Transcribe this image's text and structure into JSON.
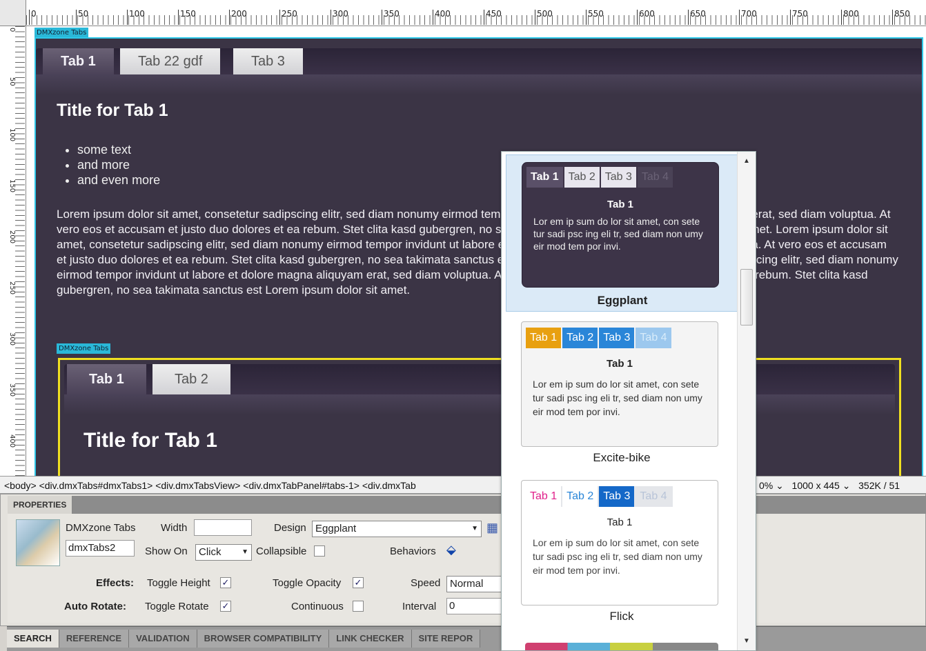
{
  "ruler": {
    "labels": [
      "0",
      "50",
      "100",
      "150",
      "200",
      "250",
      "300",
      "350",
      "400",
      "450",
      "500",
      "550",
      "600",
      "650",
      "700",
      "750",
      "800",
      "850"
    ],
    "vlabels": [
      "0",
      "50",
      "100",
      "150",
      "200",
      "250",
      "300",
      "350",
      "400",
      "450"
    ]
  },
  "outer": {
    "label": "DMXzone Tabs",
    "tabs": [
      "Tab 1",
      "Tab 22 gdf",
      "Tab 3"
    ],
    "title": "Title for Tab 1",
    "bullets": [
      "some text",
      "and more",
      "and even more"
    ],
    "lorem": "Lorem ipsum dolor sit amet, consetetur sadipscing elitr, sed diam nonumy eirmod tempor invidunt ut labore et dolore magna aliquyam erat, sed diam voluptua. At vero eos et accusam et justo duo dolores et ea rebum. Stet clita kasd gubergren, no sea takimata sanctus est Lorem ipsum dolor sit amet. Lorem ipsum dolor sit amet, consetetur sadipscing elitr, sed diam nonumy eirmod tempor invidunt ut labore et dolore magna aliquyam erat, sed diam voluptua. At vero eos et accusam et justo duo dolores et ea rebum. Stet clita kasd gubergren, no sea takimata sanctus est Lorem ipsum dolor sit amet, consetetur sadipscing elitr, sed diam nonumy eirmod tempor invidunt ut labore et dolore magna aliquyam erat, sed diam voluptua. At vero eos et accusam et justo duo dolores et ea rebum. Stet clita kasd gubergren, no sea takimata sanctus est Lorem ipsum dolor sit amet."
  },
  "inner": {
    "label": "DMXzone Tabs",
    "tabs": [
      "Tab 1",
      "Tab 2"
    ],
    "title": "Title for Tab 1"
  },
  "tagbar": {
    "path": "<body> <div.dmxTabs#dmxTabs1> <div.dmxTabsView> <div.dmxTabPanel#tabs-1> <div.dmxTab",
    "zoom": "0%",
    "size": "1000 x 445",
    "weight": "352K / 51"
  },
  "props": {
    "header": "PROPERTIES",
    "component": "DMXzone Tabs",
    "id": "dmxTabs2",
    "width_label": "Width",
    "width_value": "",
    "design_label": "Design",
    "design_value": "Eggplant",
    "showon_label": "Show On",
    "showon_value": "Click",
    "collapsible_label": "Collapsible",
    "behaviors_label": "Behaviors",
    "effects_label": "Effects:",
    "toggle_height": "Toggle Height",
    "toggle_opacity": "Toggle Opacity",
    "speed_label": "Speed",
    "speed_value": "Normal",
    "autorotate_label": "Auto Rotate:",
    "toggle_rotate": "Toggle Rotate",
    "continuous": "Continuous",
    "interval_label": "Interval",
    "interval_value": "0"
  },
  "bottomtabs": [
    "Search",
    "Reference",
    "Validation",
    "Browser Compatibility",
    "Link Checker",
    "Site Repor"
  ],
  "popup": {
    "options": [
      {
        "name": "Eggplant",
        "tabs": [
          "Tab 1",
          "Tab 2",
          "Tab 3",
          "Tab 4"
        ],
        "title": "Tab 1",
        "text": "Lor em ip sum do lor sit amet, con sete tur sadi psc ing eli tr, sed diam non umy eir mod tem por invi."
      },
      {
        "name": "Excite-bike",
        "tabs": [
          "Tab 1",
          "Tab 2",
          "Tab 3",
          "Tab 4"
        ],
        "title": "Tab 1",
        "text": "Lor em ip sum do lor sit amet, con sete tur sadi psc ing eli tr, sed diam non umy eir mod tem por invi."
      },
      {
        "name": "Flick",
        "tabs": [
          "Tab 1",
          "Tab 2",
          "Tab 3",
          "Tab 4"
        ],
        "title": "Tab 1",
        "text": "Lor em ip sum do lor sit amet, con sete tur sadi psc ing eli tr, sed diam non umy eir mod tem por invi."
      }
    ]
  }
}
